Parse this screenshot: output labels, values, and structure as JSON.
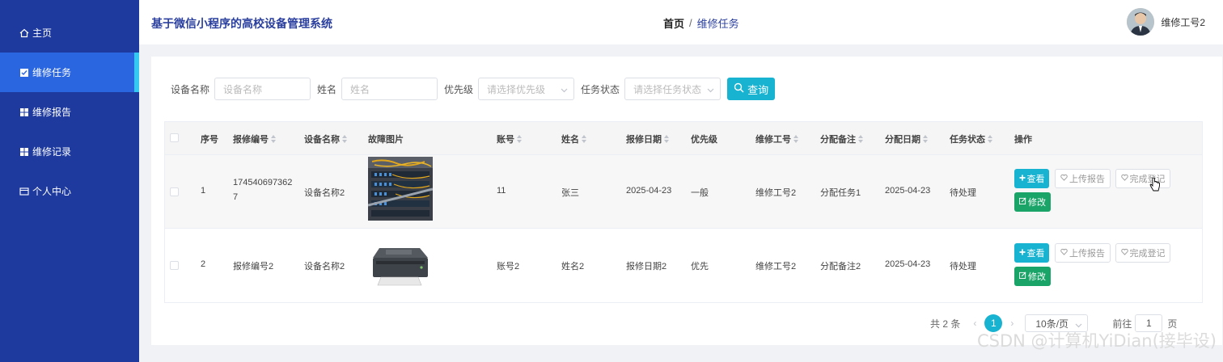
{
  "sidebar": {
    "items": [
      {
        "label": "主页",
        "icon": "home-icon"
      },
      {
        "label": "维修任务",
        "icon": "checkbox-icon",
        "active": true
      },
      {
        "label": "维修报告",
        "icon": "grid-icon"
      },
      {
        "label": "维修记录",
        "icon": "grid-icon"
      },
      {
        "label": "个人中心",
        "icon": "id-card-icon"
      }
    ]
  },
  "header": {
    "title": "基于微信小程序的高校设备管理系统",
    "breadcrumb": {
      "home": "首页",
      "separator": "/",
      "current": "维修任务"
    },
    "user_name": "维修工号2"
  },
  "filters": {
    "device_name_label": "设备名称",
    "device_name_placeholder": "设备名称",
    "name_label": "姓名",
    "name_placeholder": "姓名",
    "priority_label": "优先级",
    "priority_placeholder": "请选择优先级",
    "status_label": "任务状态",
    "status_placeholder": "请选择任务状态",
    "search_label": "查询"
  },
  "table": {
    "columns": [
      "序号",
      "报修编号",
      "设备名称",
      "故障图片",
      "账号",
      "姓名",
      "报修日期",
      "优先级",
      "维修工号",
      "分配备注",
      "分配日期",
      "任务状态",
      "操作"
    ],
    "rows": [
      {
        "index": "1",
        "repair_no_line1": "174540697362",
        "repair_no_line2": "7",
        "device_name": "设备名称2",
        "image": "server-rack-photo",
        "account": "11",
        "name": "张三",
        "repair_date": "2025-04-23",
        "priority": "一般",
        "worker_no": "维修工号2",
        "assign_note": "分配任务1",
        "assign_date": "2025-04-23",
        "status": "待处理"
      },
      {
        "index": "2",
        "repair_no_line1": "报修编号2",
        "repair_no_line2": "",
        "device_name": "设备名称2",
        "image": "printer-photo",
        "account": "账号2",
        "name": "姓名2",
        "repair_date": "报修日期2",
        "priority": "优先",
        "worker_no": "维修工号2",
        "assign_note": "分配备注2",
        "assign_date": "2025-04-23",
        "status": "待处理"
      }
    ],
    "actions": {
      "view": "查看",
      "upload": "上传报告",
      "complete": "完成登记",
      "edit": "修改"
    }
  },
  "pagination": {
    "total": "共 2 条",
    "current_page": "1",
    "page_size": "10条/页",
    "goto_prefix": "前往",
    "goto_value": "1",
    "goto_suffix": "页"
  },
  "watermark": "CSDN @计算机YiDian(接毕设)",
  "colors": {
    "sidebar": "#1e3a9e",
    "active": "#2a66e0",
    "accent": "#17b3d1",
    "success": "#1aa468"
  }
}
